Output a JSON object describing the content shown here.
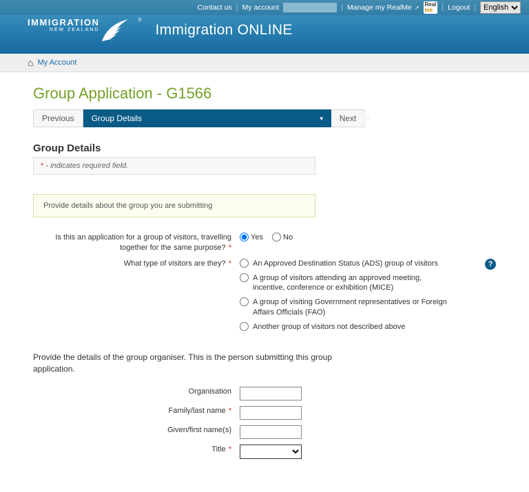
{
  "topbar": {
    "contact": "Contact us",
    "my_account": "My account",
    "manage_realme": "Manage my RealMe",
    "logout": "Logout",
    "language": "English",
    "realme_top": "Real",
    "realme_bottom": "me"
  },
  "branding": {
    "logo_line1": "IMMIGRATION",
    "logo_line2": "NEW ZEALAND",
    "app_title": "Immigration ONLINE"
  },
  "breadcrumb": {
    "my_account": "My Account"
  },
  "page": {
    "title": "Group Application - G1566"
  },
  "steps": {
    "previous": "Previous",
    "current": "Group Details",
    "next": "Next"
  },
  "section": {
    "title": "Group Details",
    "required_note": "- indicates required field.",
    "info": "Provide details about the group you are submitting"
  },
  "q_group_visitors": {
    "label": "Is this an application for a group of visitors, travelling together for the same purpose?",
    "yes": "Yes",
    "no": "No",
    "selected": "yes"
  },
  "q_visitor_type": {
    "label": "What type of visitors are they?",
    "options": [
      "An Approved Destination Status (ADS) group of visitors",
      "A group of visitors attending an approved meeting, incentive, conference or exhibition (MICE)",
      "A group of visiting Government representatives or Foreign Affairs Officials (FAO)",
      "Another group of visitors not described above"
    ]
  },
  "organiser": {
    "intro": "Provide the details of the group organiser. This is the person submitting this group application.",
    "fields": {
      "organisation_label": "Organisation",
      "family_label": "Family/last name",
      "given_label": "Given/first name(s)",
      "title_label": "Title"
    }
  }
}
